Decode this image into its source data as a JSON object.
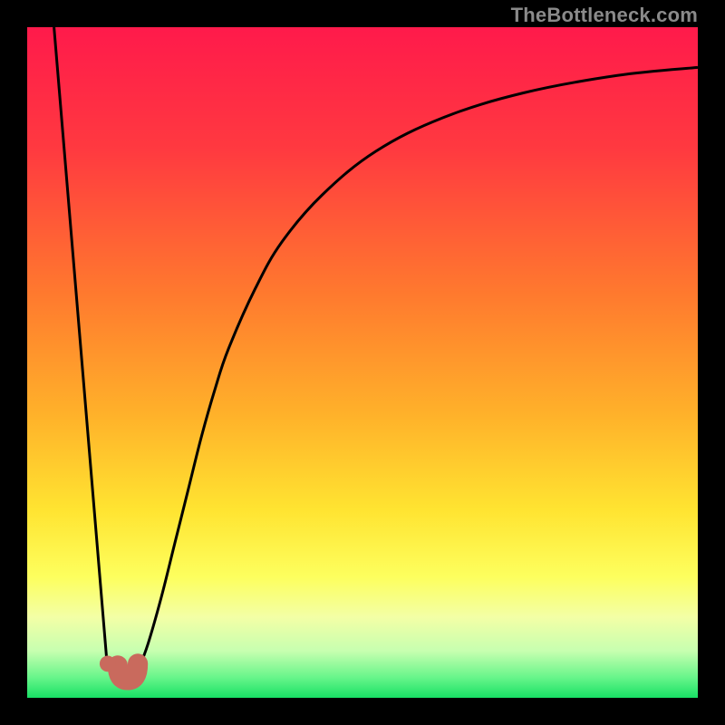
{
  "watermark": "TheBottleneck.com",
  "chart_data": {
    "type": "line",
    "title": "",
    "xlabel": "",
    "ylabel": "",
    "xlim": [
      0,
      100
    ],
    "ylim": [
      0,
      100
    ],
    "gradient_stops": [
      {
        "offset": 0.0,
        "color": "#ff1a4b"
      },
      {
        "offset": 0.18,
        "color": "#ff3940"
      },
      {
        "offset": 0.4,
        "color": "#ff7a2e"
      },
      {
        "offset": 0.58,
        "color": "#ffb22a"
      },
      {
        "offset": 0.72,
        "color": "#ffe431"
      },
      {
        "offset": 0.82,
        "color": "#fdff5e"
      },
      {
        "offset": 0.88,
        "color": "#f3ffa6"
      },
      {
        "offset": 0.93,
        "color": "#c7ffb0"
      },
      {
        "offset": 0.97,
        "color": "#67f58a"
      },
      {
        "offset": 1.0,
        "color": "#18e065"
      }
    ],
    "series": [
      {
        "name": "left-branch",
        "x": [
          4.0,
          12.0
        ],
        "y": [
          100.0,
          4.0
        ]
      },
      {
        "name": "right-branch",
        "x": [
          16.5,
          18.0,
          20.0,
          22.0,
          24.0,
          26.0,
          28.0,
          30.0,
          34.0,
          38.0,
          44.0,
          52.0,
          62.0,
          74.0,
          88.0,
          100.0
        ],
        "y": [
          4.0,
          8.0,
          15.0,
          23.0,
          31.0,
          39.0,
          46.0,
          52.0,
          61.0,
          68.0,
          75.0,
          81.5,
          86.5,
          90.2,
          92.8,
          94.0
        ]
      }
    ],
    "marker": {
      "dot": {
        "x": 12.0,
        "y": 4.0,
        "r": 1.2,
        "color": "#c96a5d"
      },
      "hook": {
        "x0": 13.5,
        "y0": 4.0,
        "x1": 16.5,
        "y1": 4.0,
        "width": 3.0,
        "color": "#c96a5d"
      }
    }
  }
}
